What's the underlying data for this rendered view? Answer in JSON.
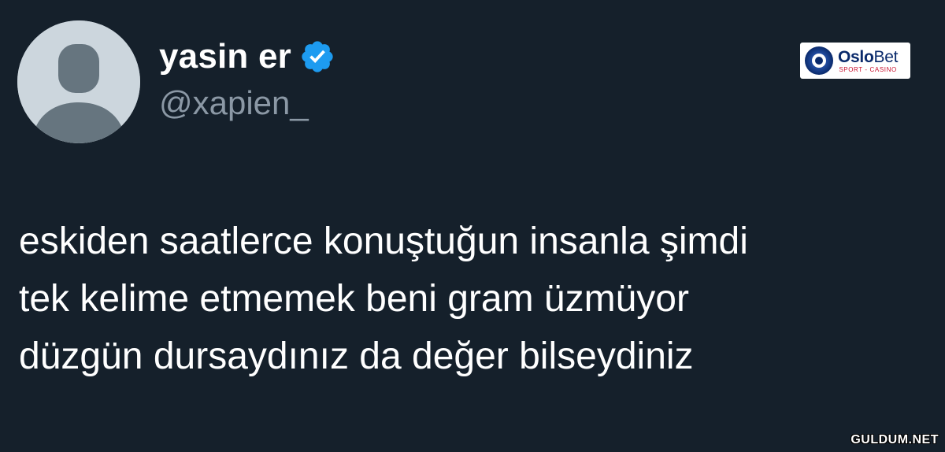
{
  "tweet": {
    "display_name": "yasin er",
    "handle": "@xapien_",
    "verified": true,
    "verified_color": "#1d9bf0",
    "text_lines": [
      "eskiden saatlerce konuştuğun insanla şimdi",
      "tek kelime etmemek beni gram üzmüyor",
      "düzgün dursaydınız da değer bilseydiniz"
    ]
  },
  "sponsor": {
    "brand_primary": "Oslo",
    "brand_secondary": "Bet",
    "tagline": "SPORT - CASINO"
  },
  "watermark": {
    "text": "GULDUM.NET"
  },
  "colors": {
    "background": "#15202b",
    "text": "#ffffff",
    "handle": "#8b98a5",
    "avatar_bg": "#ccd6dd",
    "avatar_figure": "#66757f"
  },
  "icons": {
    "avatar": "default-profile-silhouette-icon",
    "verified": "verified-badge-icon",
    "sponsor_logo": "oslobet-logo-icon"
  }
}
